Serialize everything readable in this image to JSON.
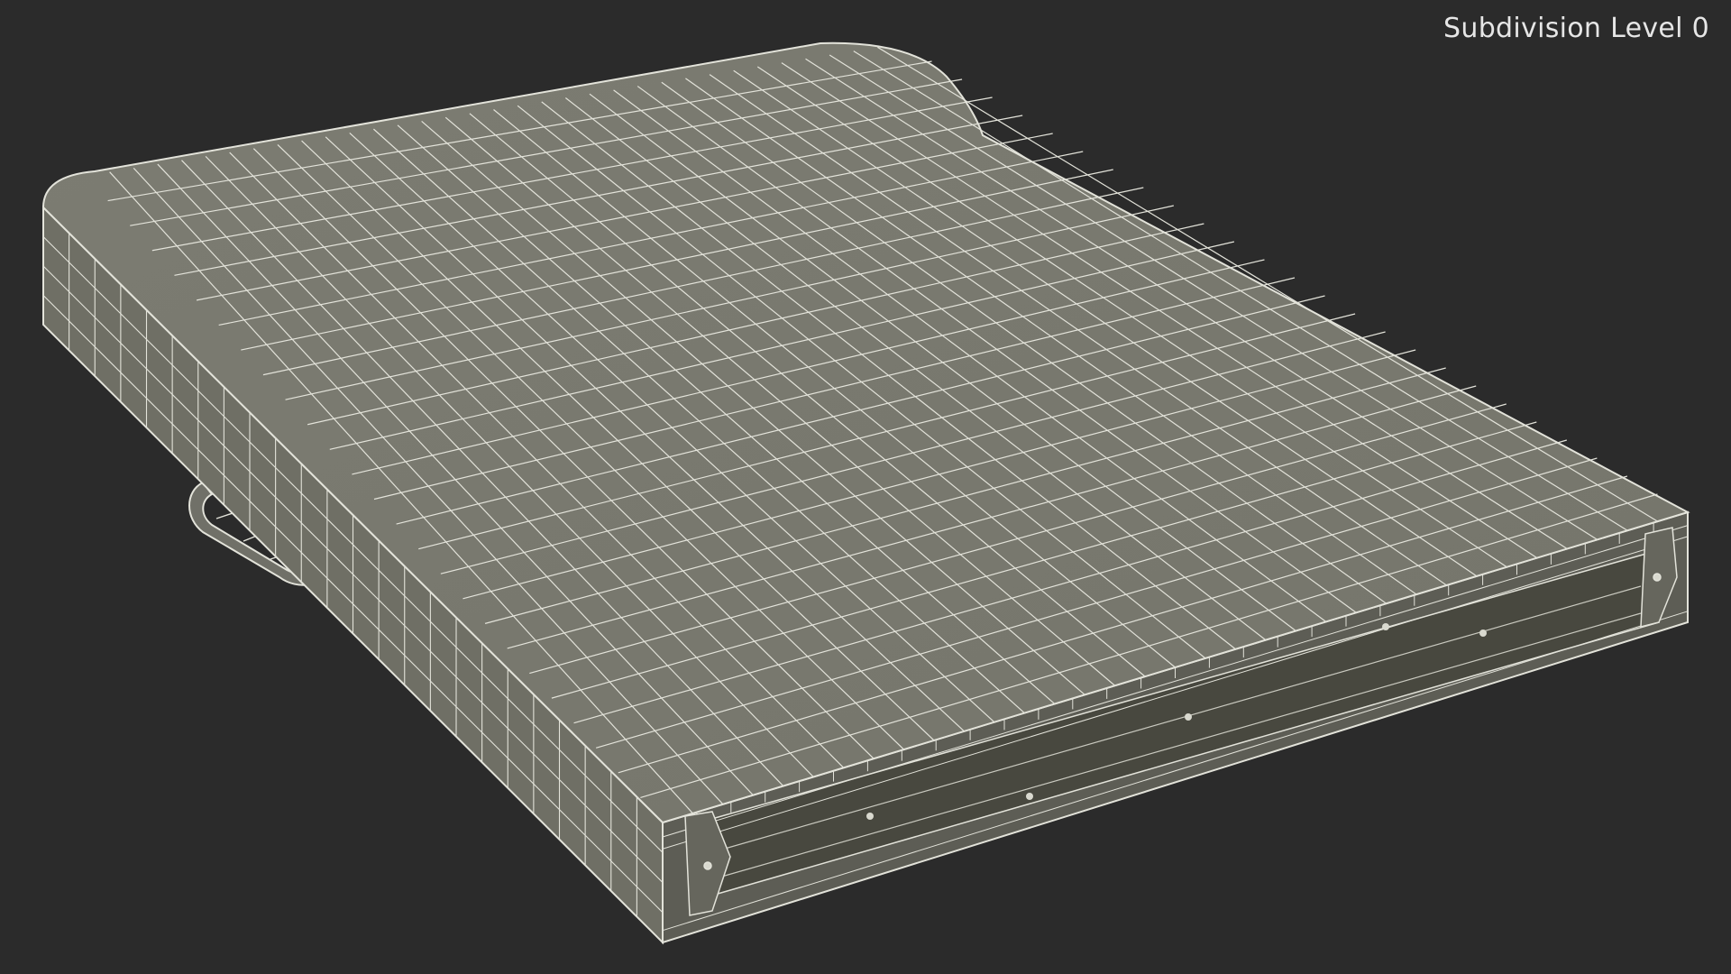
{
  "overlay": {
    "label": "Subdivision Level 0"
  },
  "model": {
    "subject": "folding-table-case-wireframe",
    "colors": {
      "background": "#2b2b2b",
      "surface": "#7a7a6f",
      "side": "#6f6f65",
      "front": "#5d5d55",
      "wire": "#e3e3da",
      "interior": "#48483f"
    }
  }
}
